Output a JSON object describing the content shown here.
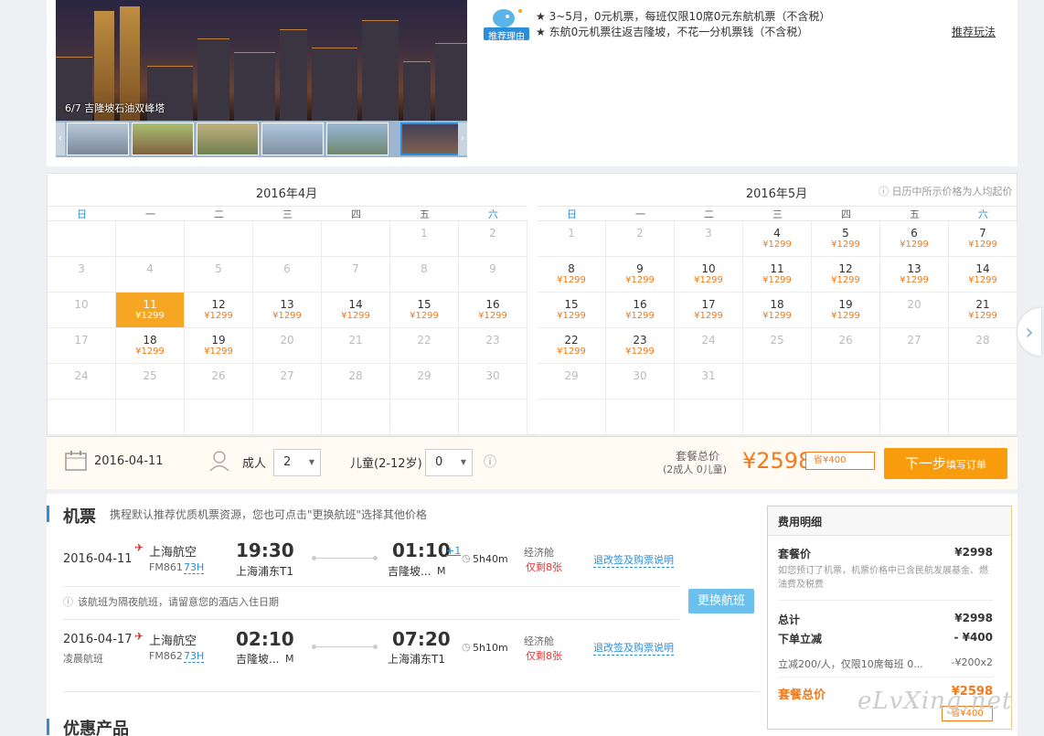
{
  "hero": {
    "caption": "6/7 吉隆坡石油双峰塔"
  },
  "recommend": {
    "icon_label": "推荐理由",
    "lines": [
      "★ 3~5月，0元机票，每班仅限10席0元东航机票（不含税）",
      "★ 东航0元机票往返吉隆坡，不花一分机票钱（不含税）"
    ],
    "link": "推荐玩法"
  },
  "calendar": {
    "note": "日历中所示价格为人均起价",
    "weekdays": [
      "日",
      "一",
      "二",
      "三",
      "四",
      "五",
      "六"
    ],
    "months": [
      {
        "title": "2016年4月",
        "rows": [
          [
            {
              "d": ""
            },
            {
              "d": ""
            },
            {
              "d": ""
            },
            {
              "d": ""
            },
            {
              "d": ""
            },
            {
              "d": "1"
            },
            {
              "d": "2"
            }
          ],
          [
            {
              "d": "3"
            },
            {
              "d": "4"
            },
            {
              "d": "5"
            },
            {
              "d": "6"
            },
            {
              "d": "7"
            },
            {
              "d": "8"
            },
            {
              "d": "9"
            }
          ],
          [
            {
              "d": "10"
            },
            {
              "d": "11",
              "p": "¥1299",
              "sel": true
            },
            {
              "d": "12",
              "p": "¥1299"
            },
            {
              "d": "13",
              "p": "¥1299"
            },
            {
              "d": "14",
              "p": "¥1299"
            },
            {
              "d": "15",
              "p": "¥1299"
            },
            {
              "d": "16",
              "p": "¥1299"
            }
          ],
          [
            {
              "d": "17"
            },
            {
              "d": "18",
              "p": "¥1299"
            },
            {
              "d": "19",
              "p": "¥1299"
            },
            {
              "d": "20"
            },
            {
              "d": "21"
            },
            {
              "d": "22"
            },
            {
              "d": "23"
            }
          ],
          [
            {
              "d": "24"
            },
            {
              "d": "25"
            },
            {
              "d": "26"
            },
            {
              "d": "27"
            },
            {
              "d": "28"
            },
            {
              "d": "29"
            },
            {
              "d": "30"
            }
          ],
          [
            {
              "d": ""
            },
            {
              "d": ""
            },
            {
              "d": ""
            },
            {
              "d": ""
            },
            {
              "d": ""
            },
            {
              "d": ""
            },
            {
              "d": ""
            }
          ]
        ]
      },
      {
        "title": "2016年5月",
        "rows": [
          [
            {
              "d": "1"
            },
            {
              "d": "2"
            },
            {
              "d": "3"
            },
            {
              "d": "4",
              "p": "¥1299"
            },
            {
              "d": "5",
              "p": "¥1299"
            },
            {
              "d": "6",
              "p": "¥1299"
            },
            {
              "d": "7",
              "p": "¥1299"
            }
          ],
          [
            {
              "d": "8",
              "p": "¥1299"
            },
            {
              "d": "9",
              "p": "¥1299"
            },
            {
              "d": "10",
              "p": "¥1299"
            },
            {
              "d": "11",
              "p": "¥1299"
            },
            {
              "d": "12",
              "p": "¥1299"
            },
            {
              "d": "13",
              "p": "¥1299"
            },
            {
              "d": "14",
              "p": "¥1299"
            }
          ],
          [
            {
              "d": "15",
              "p": "¥1299"
            },
            {
              "d": "16",
              "p": "¥1299"
            },
            {
              "d": "17",
              "p": "¥1299"
            },
            {
              "d": "18",
              "p": "¥1299"
            },
            {
              "d": "19",
              "p": "¥1299"
            },
            {
              "d": "20"
            },
            {
              "d": "21",
              "p": "¥1299"
            }
          ],
          [
            {
              "d": "22",
              "p": "¥1299"
            },
            {
              "d": "23",
              "p": "¥1299"
            },
            {
              "d": "24"
            },
            {
              "d": "25"
            },
            {
              "d": "26"
            },
            {
              "d": "27"
            },
            {
              "d": "28"
            }
          ],
          [
            {
              "d": "29"
            },
            {
              "d": "30"
            },
            {
              "d": "31"
            },
            {
              "d": ""
            },
            {
              "d": ""
            },
            {
              "d": ""
            },
            {
              "d": ""
            }
          ],
          [
            {
              "d": ""
            },
            {
              "d": ""
            },
            {
              "d": ""
            },
            {
              "d": ""
            },
            {
              "d": ""
            },
            {
              "d": ""
            },
            {
              "d": ""
            }
          ]
        ]
      }
    ]
  },
  "order": {
    "date": "2016-04-11",
    "adult_label": "成人",
    "adult_value": "2",
    "child_label": "儿童(2-12岁)",
    "child_value": "0",
    "total_label": "套餐总价",
    "total_sub": "(2成人 0儿童)",
    "total_price": "¥2598",
    "save": "省¥400",
    "next_btn": "下一步",
    "next_btn_sub": "填写订单"
  },
  "flights": {
    "title": "机票",
    "subtitle": "携程默认推荐优质机票资源，您也可点击\"更换航班\"选择其他价格",
    "change_btn": "更换航班",
    "night_note": "该航班为隔夜航班，请留意您的酒店入住日期",
    "items": [
      {
        "date": "2016-04-11",
        "sub": "",
        "airline": "上海航空",
        "flight": "FM861",
        "plane": "73H",
        "dep_time": "19:30",
        "dep_airport": "上海浦东T1",
        "arr_time": "01:10",
        "plus": "+1",
        "arr_airport": "吉隆坡...",
        "arr_term": "M",
        "duration": "5h40m",
        "cabin": "经济舱",
        "left": "仅剩8张",
        "rule": "退改签及购票说明"
      },
      {
        "date": "2016-04-17",
        "sub": "凌晨航班",
        "airline": "上海航空",
        "flight": "FM862",
        "plane": "73H",
        "dep_time": "02:10",
        "dep_airport": "吉隆坡...",
        "dep_term": "M",
        "arr_time": "07:20",
        "plus": "",
        "arr_airport": "上海浦东T1",
        "arr_term": "",
        "duration": "5h10m",
        "cabin": "经济舱",
        "left": "仅剩8张",
        "rule": "退改签及购票说明"
      }
    ]
  },
  "fees": {
    "title": "费用明细",
    "package_label": "套餐价",
    "package_value": "¥2998",
    "package_note": "如您预订了机票，机票价格中已含民航发展基金、燃油费及税费",
    "total_label": "总计",
    "total_value": "¥2998",
    "discount_label": "下单立减",
    "discount_value": "- ¥400",
    "discount_detail": "立减200/人，仅限10席每班 0...",
    "discount_detail_value": "-¥200x2",
    "final_label": "套餐总价",
    "final_value": "¥2598",
    "final_save": "省¥400"
  },
  "promo": {
    "title": "优惠产品"
  },
  "watermark": "eLvXing.net"
}
